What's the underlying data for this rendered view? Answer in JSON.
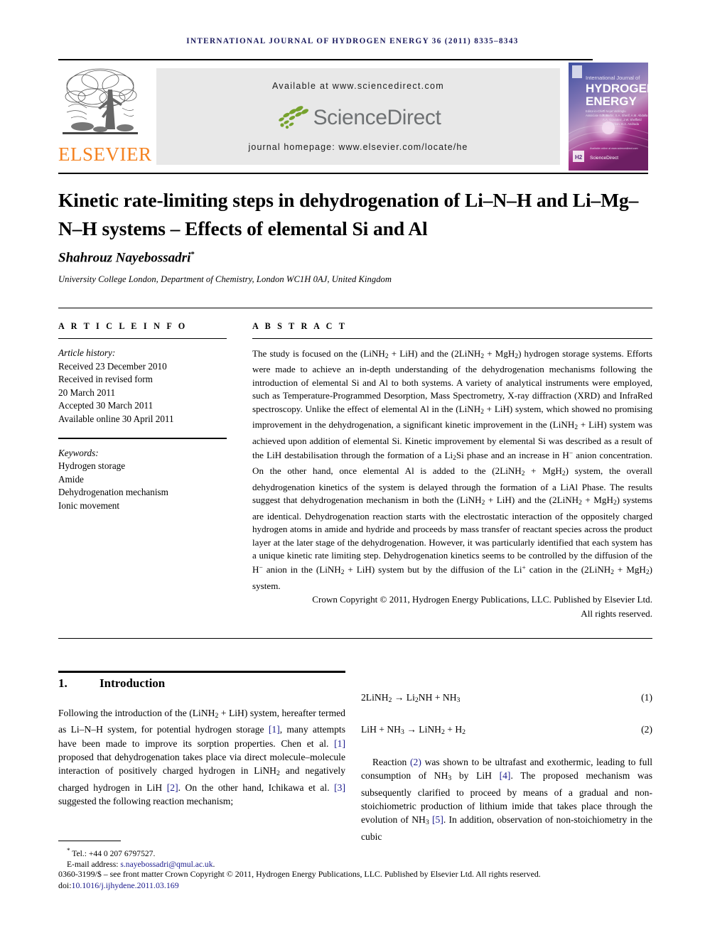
{
  "running_head": "International Journal of Hydrogen Energy 36 (2011) 8335–8343",
  "publisher": {
    "elsevier_wordmark": "ELSEVIER",
    "elsevier_color": "#F58220"
  },
  "sciencedirect_banner": {
    "available_at": "Available at www.sciencedirect.com",
    "logo_text": "ScienceDirect",
    "journal_homepage": "journal homepage: www.elsevier.com/locate/he",
    "background": "#e8e8e8",
    "logo_color": "#6e7173",
    "leaf_color": "#76a22d"
  },
  "cover": {
    "line1": "International Journal of",
    "line2": "HYDROGEN",
    "line3": "ENERGY",
    "footer_text": "ScienceDirect"
  },
  "article": {
    "title": "Kinetic rate-limiting steps in dehydrogenation of Li–N–H and Li–Mg–N–H systems – Effects of elemental Si and Al",
    "author": "Shahrouz Nayebossadri",
    "author_marker": "*",
    "affiliation": "University College London, Department of Chemistry, London WC1H 0AJ, United Kingdom"
  },
  "article_info": {
    "heading": "A R T I C L E  I N F O",
    "history_label": "Article history:",
    "history": [
      "Received 23 December 2010",
      "Received in revised form",
      "20 March 2011",
      "Accepted 30 March 2011",
      "Available online 30 April 2011"
    ],
    "keywords_label": "Keywords:",
    "keywords": [
      "Hydrogen storage",
      "Amide",
      "Dehydrogenation mechanism",
      "Ionic movement"
    ]
  },
  "abstract": {
    "heading": "A B S T R A C T",
    "body_html": "The study is focused on the (LiNH<sub>2</sub> + LiH) and the (2LiNH<sub>2</sub> + MgH<sub>2</sub>) hydrogen storage systems. Efforts were made to achieve an in-depth understanding of the dehydrogenation mechanisms following the introduction of elemental Si and Al to both systems. A variety of analytical instruments were employed, such as Temperature-Programmed Desorption, Mass Spectrometry, X-ray diffraction (XRD) and InfraRed spectroscopy. Unlike the effect of elemental Al in the (LiNH<sub>2</sub> + LiH) system, which showed no promising improvement in the dehydrogenation, a significant kinetic improvement in the (LiNH<sub>2</sub> + LiH) system was achieved upon addition of elemental Si. Kinetic improvement by elemental Si was described as a result of the LiH destabilisation through the formation of a Li<sub>2</sub>Si phase and an increase in H<sup>−</sup> anion concentration. On the other hand, once elemental Al is added to the (2LiNH<sub>2</sub> + MgH<sub>2</sub>) system, the overall dehydrogenation kinetics of the system is delayed through the formation of a LiAl Phase. The results suggest that dehydrogenation mechanism in both the (LiNH<sub>2</sub> + LiH) and the (2LiNH<sub>2</sub> + MgH<sub>2</sub>) systems are identical. Dehydrogenation reaction starts with the electrostatic interaction of the oppositely charged hydrogen atoms in amide and hydride and proceeds by mass transfer of reactant species across the product layer at the later stage of the dehydrogenation. However, it was particularly identified that each system has a unique kinetic rate limiting step. Dehydrogenation kinetics seems to be controlled by the diffusion of the H<sup>−</sup> anion in the (LiNH<sub>2</sub> + LiH) system but by the diffusion of the Li<sup>+</sup> cation in the (2LiNH<sub>2</sub> + MgH<sub>2</sub>) system.",
    "copyright_line1": "Crown Copyright © 2011, Hydrogen Energy Publications, LLC. Published by Elsevier Ltd.",
    "copyright_line2": "All rights reserved."
  },
  "introduction": {
    "number": "1.",
    "heading": "Introduction",
    "para1_html": "Following the introduction of the (LiNH<sub>2</sub> + LiH) system, hereafter termed as Li–N–H system, for potential hydrogen storage <span class=\"ref\">[1]</span>, many attempts have been made to improve its sorption properties. Chen et al. <span class=\"ref\">[1]</span> proposed that dehydrogenation takes place via direct molecule–molecule interaction of positively charged hydrogen in LiNH<sub>2</sub> and negatively charged hydrogen in LiH <span class=\"ref\">[2]</span>. On the other hand, Ichikawa et al. <span class=\"ref\">[3]</span> suggested the following reaction mechanism;",
    "equations": [
      {
        "expr_html": "2LiNH<sub>2</sub> → Li<sub>2</sub>NH + NH<sub>3</sub>",
        "number": "(1)"
      },
      {
        "expr_html": "LiH + NH<sub>3</sub> → LiNH<sub>2</sub> + H<sub>2</sub>",
        "number": "(2)"
      }
    ],
    "para2_html": "Reaction <span class=\"ref\">(2)</span> was shown to be ultrafast and exothermic, leading to full consumption of NH<sub>3</sub> by LiH <span class=\"ref\">[4]</span>. The proposed mechanism was subsequently clarified to proceed by means of a gradual and non-stoichiometric production of lithium imide that takes place through the evolution of NH<sub>3</sub> <span class=\"ref\">[5]</span>. In addition, observation of non-stoichiometry in the cubic"
  },
  "footer": {
    "tel_marker": "*",
    "tel": "Tel.: +44 0 207 6797527.",
    "email_label": "E-mail address:",
    "email": "s.nayebossadri@qmul.ac.uk",
    "issn_line": "0360-3199/$ – see front matter Crown Copyright © 2011, Hydrogen Energy Publications, LLC. Published by Elsevier Ltd. All rights reserved.",
    "doi_prefix": "doi:",
    "doi": "10.1016/j.ijhydene.2011.03.169"
  }
}
